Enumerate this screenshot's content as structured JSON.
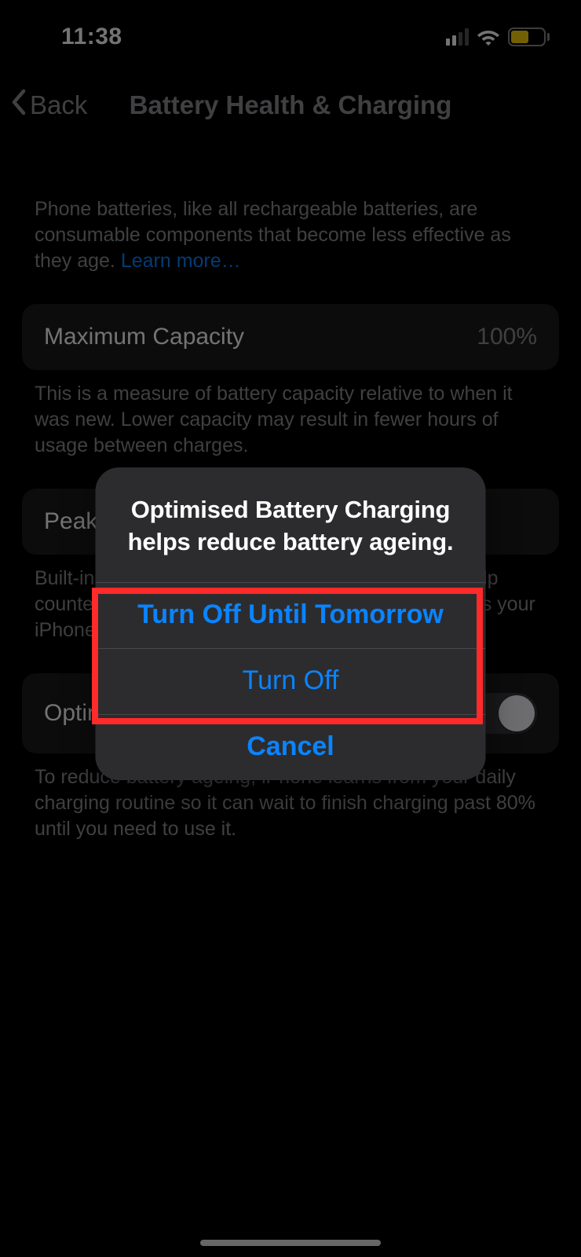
{
  "status": {
    "time": "11:38"
  },
  "nav": {
    "back": "Back",
    "title": "Battery Health & Charging"
  },
  "intro": {
    "text": "Phone batteries, like all rechargeable batteries, are consumable components that become less effective as they age. ",
    "link": "Learn more…"
  },
  "capacity": {
    "label": "Maximum Capacity",
    "value": "100%",
    "desc": "This is a measure of battery capacity relative to when it was new. Lower capacity may result in fewer hours of usage between charges."
  },
  "peak": {
    "label": "Peak Performance Capability",
    "desc": "Built-in dynamic software and hardware systems help counter performance impacts that may be noticed as your iPhone battery chemically ages."
  },
  "optimised": {
    "label": "Optimised Battery Charging",
    "desc": "To reduce battery ageing, iPhone learns from your daily charging routine so it can wait to finish charging past 80% until you need to use it."
  },
  "sheet": {
    "title": "Optimised Battery Charging helps reduce battery ageing.",
    "option1": "Turn Off Until Tomorrow",
    "option2": "Turn Off",
    "cancel": "Cancel"
  }
}
